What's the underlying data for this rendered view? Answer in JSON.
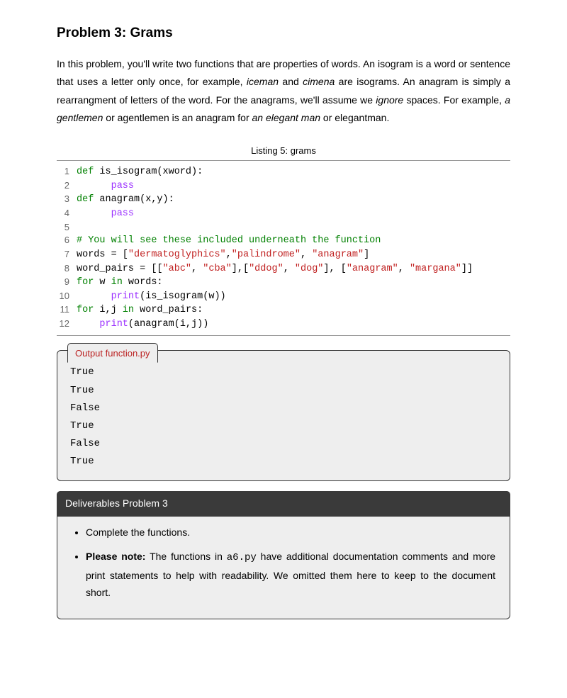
{
  "title": "Problem 3: Grams",
  "intro": {
    "p1a": "In this problem, you'll write two functions that are properties of words. An isogram is a word or sentence that uses a letter only once, for example, ",
    "iceman": "iceman",
    "p1b": " and ",
    "cimena": "cimena",
    "p1c": " are isograms. An anagram is simply a rearrangment of letters of the word. For the anagrams, we'll assume we ",
    "ignore": "ignore",
    "p1d": " spaces. For example, ",
    "agentlemen": "a gentlemen",
    "p1e": " or agentlemen is an anagram for ",
    "anelegantman": "an elegant man",
    "p1f": " or elegantman."
  },
  "listing_caption": "Listing 5: grams",
  "code": {
    "l1": {
      "n": "1",
      "a": "def",
      "b": " is_isogram(xword):"
    },
    "l2": {
      "n": "2",
      "a": "      ",
      "b": "pass"
    },
    "l3": {
      "n": "3",
      "a": "def",
      "b": " anagram(x,y):"
    },
    "l4": {
      "n": "4",
      "a": "      ",
      "b": "pass"
    },
    "l5": {
      "n": "5"
    },
    "l6": {
      "n": "6",
      "a": "# You will see these included underneath the function"
    },
    "l7": {
      "n": "7",
      "a": "words = [",
      "s1": "\"dermatoglyphics\"",
      "c1": ",",
      "s2": "\"palindrome\"",
      "c2": ", ",
      "s3": "\"anagram\"",
      "b": "]"
    },
    "l8": {
      "n": "8",
      "a": "word_pairs = [[",
      "s1": "\"abc\"",
      "c1": ", ",
      "s2": "\"cba\"",
      "c2": "],[",
      "s3": "\"ddog\"",
      "c3": ", ",
      "s4": "\"dog\"",
      "c4": "], [",
      "s5": "\"anagram\"",
      "c5": ", ",
      "s6": "\"margana\"",
      "b": "]]"
    },
    "l9": {
      "n": "9",
      "a": "for",
      "b": " w ",
      "c": "in",
      "d": " words:"
    },
    "l10": {
      "n": "10",
      "a": "      ",
      "b": "print",
      "c": "(is_isogram(w))"
    },
    "l11": {
      "n": "11",
      "a": "for",
      "b": " i,j ",
      "c": "in",
      "d": " word_pairs:"
    },
    "l12": {
      "n": "12",
      "a": "    ",
      "b": "print",
      "c": "(anagram(i,j))"
    }
  },
  "output": {
    "title": "Output function.py",
    "lines": [
      "True",
      "True",
      "False",
      "True",
      "False",
      "True"
    ]
  },
  "deliverables": {
    "title": "Deliverables Problem 3",
    "item1": "Complete the functions.",
    "item2a": "Please note:",
    "item2b": " The functions in ",
    "item2c": "a6.py",
    "item2d": " have additional documentation comments and more print statements to help with readability. We omitted them here to keep to the document short."
  }
}
